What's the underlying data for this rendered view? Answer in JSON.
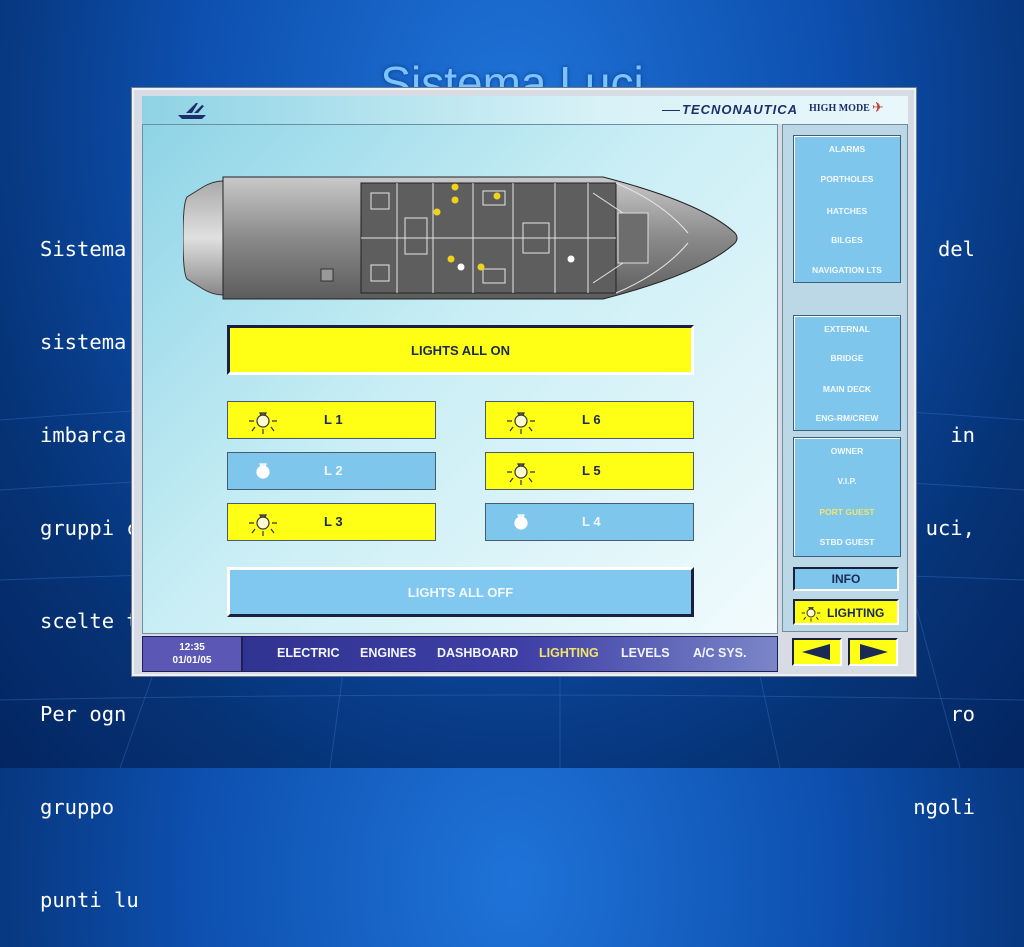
{
  "slide": {
    "title": "Sistema Luci",
    "lines": [
      {
        "left": "Sistema",
        "right": "del"
      },
      {
        "left": "sistema",
        "right": ""
      },
      {
        "left": "imbarca",
        "right": "in"
      },
      {
        "left": "gruppi c",
        "right": "uci,"
      },
      {
        "left": "scelte t",
        "right": ""
      },
      {
        "left": "Per ogn",
        "right": "ro"
      },
      {
        "left": "gruppo",
        "right": "ngoli"
      },
      {
        "left": "punti lu",
        "right": ""
      }
    ]
  },
  "header": {
    "brand": "TECNONAUTICA",
    "mode": "HIGH MODE"
  },
  "lighting": {
    "all_on_label": "LIGHTS ALL ON",
    "all_off_label": "LIGHTS ALL OFF",
    "groups": [
      {
        "label": "L 1",
        "state": "on"
      },
      {
        "label": "L 2",
        "state": "off"
      },
      {
        "label": "L 3",
        "state": "on"
      },
      {
        "label": "L 6",
        "state": "on"
      },
      {
        "label": "L 5",
        "state": "on"
      },
      {
        "label": "L 4",
        "state": "off"
      }
    ]
  },
  "sidebar": {
    "group1": [
      "ALARMS",
      "PORTHOLES",
      "HATCHES",
      "BILGES",
      "NAVIGATION LTS"
    ],
    "group2": [
      "EXTERNAL",
      "BRIDGE",
      "MAIN DECK",
      "ENG-RM/CREW"
    ],
    "group3": [
      "OWNER",
      "V.I.P.",
      "PORT GUEST",
      "STBD GUEST"
    ],
    "active": "PORT GUEST",
    "info_label": "INFO",
    "lighting_label": "LIGHTING"
  },
  "status": {
    "time": "12:35",
    "date": "01/01/05"
  },
  "nav": {
    "items": [
      "ELECTRIC",
      "ENGINES",
      "DASHBOARD",
      "LIGHTING",
      "LEVELS",
      "A/C SYS."
    ],
    "active": "LIGHTING"
  },
  "colors": {
    "on": "#ffff15",
    "off": "#7fc6ed",
    "active_text": "#f2e46a",
    "bulb_lit": "#f1d21a",
    "bulb_unlit": "#ffffff"
  },
  "icons": {
    "bulb": "lightbulb-icon",
    "prev": "arrow-left-icon",
    "next": "arrow-right-icon",
    "logo": "boat-logo-icon",
    "plane": "airplane-icon"
  }
}
